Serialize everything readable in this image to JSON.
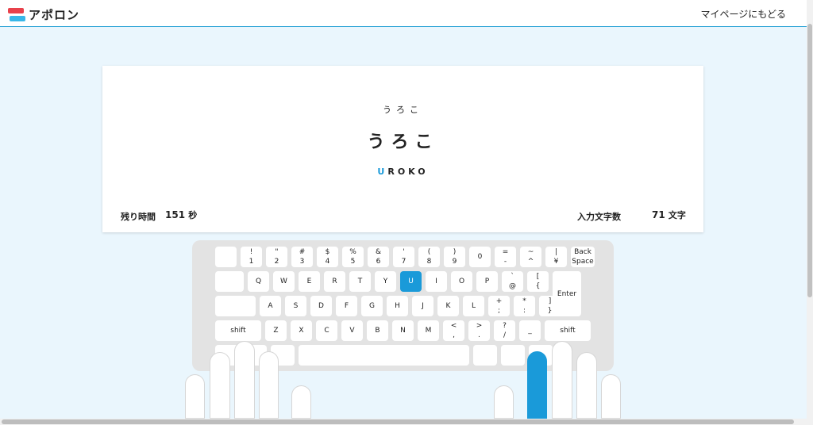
{
  "header": {
    "logo": "アポロン",
    "mypage_link": "マイページにもどる"
  },
  "prompt": {
    "kana": "うろこ",
    "word": "うろこ",
    "romaji_typed": "U",
    "romaji_rest": "ROKO"
  },
  "stats": {
    "time_label": "残り時間",
    "time_value": "151",
    "time_unit": "秒",
    "count_label": "入力文字数",
    "count_value": "71",
    "count_unit": "文字"
  },
  "keyboard": {
    "active_key": "U",
    "active_color": "#1a9ad9",
    "rows": [
      [
        [
          "",
          ""
        ],
        [
          "!",
          "1"
        ],
        [
          "\"",
          "2"
        ],
        [
          "#",
          "3"
        ],
        [
          "$",
          "4"
        ],
        [
          "%",
          "5"
        ],
        [
          "&",
          "6"
        ],
        [
          "'",
          "7"
        ],
        [
          "(",
          "8"
        ],
        [
          ")",
          "9"
        ],
        [
          "",
          "0"
        ],
        [
          "=",
          "-"
        ],
        [
          "~",
          "^"
        ],
        [
          "|",
          "¥"
        ],
        [
          "Back",
          "Space"
        ]
      ],
      [
        [
          "",
          ""
        ],
        [
          "Q",
          ""
        ],
        [
          "W",
          ""
        ],
        [
          "E",
          ""
        ],
        [
          "R",
          ""
        ],
        [
          "T",
          ""
        ],
        [
          "Y",
          ""
        ],
        [
          "U",
          ""
        ],
        [
          "I",
          ""
        ],
        [
          "O",
          ""
        ],
        [
          "P",
          ""
        ],
        [
          "`",
          "@"
        ],
        [
          "[",
          "{"
        ],
        [
          "Enter",
          ""
        ]
      ],
      [
        [
          "",
          ""
        ],
        [
          "A",
          ""
        ],
        [
          "S",
          ""
        ],
        [
          "D",
          ""
        ],
        [
          "F",
          ""
        ],
        [
          "G",
          ""
        ],
        [
          "H",
          ""
        ],
        [
          "J",
          ""
        ],
        [
          "K",
          ""
        ],
        [
          "L",
          ""
        ],
        [
          "+",
          ";"
        ],
        [
          "*",
          ":"
        ],
        [
          "]",
          "}"
        ]
      ],
      [
        [
          "shift",
          ""
        ],
        [
          "Z",
          ""
        ],
        [
          "X",
          ""
        ],
        [
          "C",
          ""
        ],
        [
          "V",
          ""
        ],
        [
          "B",
          ""
        ],
        [
          "N",
          ""
        ],
        [
          "M",
          ""
        ],
        [
          "<",
          ","
        ],
        [
          ">",
          "."
        ],
        [
          "?",
          "/"
        ],
        [
          "_",
          ""
        ],
        [
          "shift",
          ""
        ]
      ],
      [
        [
          "",
          ""
        ],
        [
          "",
          ""
        ],
        [
          "",
          ""
        ],
        [
          "",
          ""
        ],
        [
          "",
          ""
        ],
        [
          "",
          ""
        ],
        [
          "",
          ""
        ]
      ]
    ]
  }
}
